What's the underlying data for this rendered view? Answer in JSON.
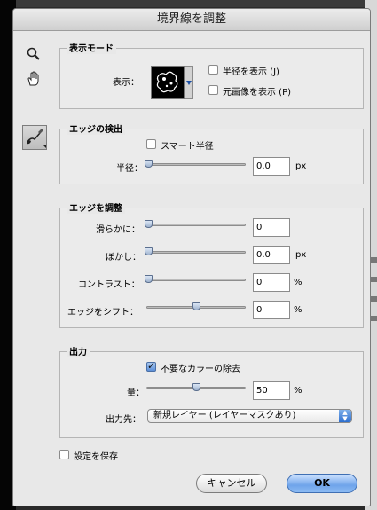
{
  "window": {
    "title": "境界線を調整"
  },
  "view_mode": {
    "title": "表示モード",
    "display_label": "表示：",
    "show_radius": {
      "label": "半径を表示 (J)",
      "checked": false
    },
    "show_original": {
      "label": "元画像を表示 (P)",
      "checked": false
    }
  },
  "edge_detection": {
    "title": "エッジの検出",
    "smart_radius": {
      "label": "スマート半径",
      "checked": false
    },
    "radius": {
      "label": "半径：",
      "value": "0.0",
      "unit": "px",
      "level": 0.0
    }
  },
  "adjust_edge": {
    "title": "エッジを調整",
    "smooth": {
      "label": "滑らかに：",
      "value": "0",
      "unit": "",
      "level": 0.0
    },
    "feather": {
      "label": "ぼかし：",
      "value": "0.0",
      "unit": "px",
      "level": 0.0
    },
    "contrast": {
      "label": "コントラスト：",
      "value": "0",
      "unit": "%",
      "level": 0.0
    },
    "shift_edge": {
      "label": "エッジをシフト：",
      "value": "0",
      "unit": "%",
      "level": 0.5
    }
  },
  "output": {
    "title": "出力",
    "decontaminate": {
      "label": "不要なカラーの除去",
      "checked": true
    },
    "amount": {
      "label": "量：",
      "value": "50",
      "unit": "%",
      "level": 0.5
    },
    "output_to": {
      "label": "出力先：",
      "selected": "新規レイヤー (レイヤーマスクあり)"
    }
  },
  "remember_settings": {
    "label": "設定を保存",
    "checked": false
  },
  "buttons": {
    "cancel": "キャンセル",
    "ok": "OK"
  },
  "icons": {
    "zoom": "zoom-icon",
    "hand": "hand-icon",
    "refine_radius": "refine-radius-brush-icon"
  }
}
